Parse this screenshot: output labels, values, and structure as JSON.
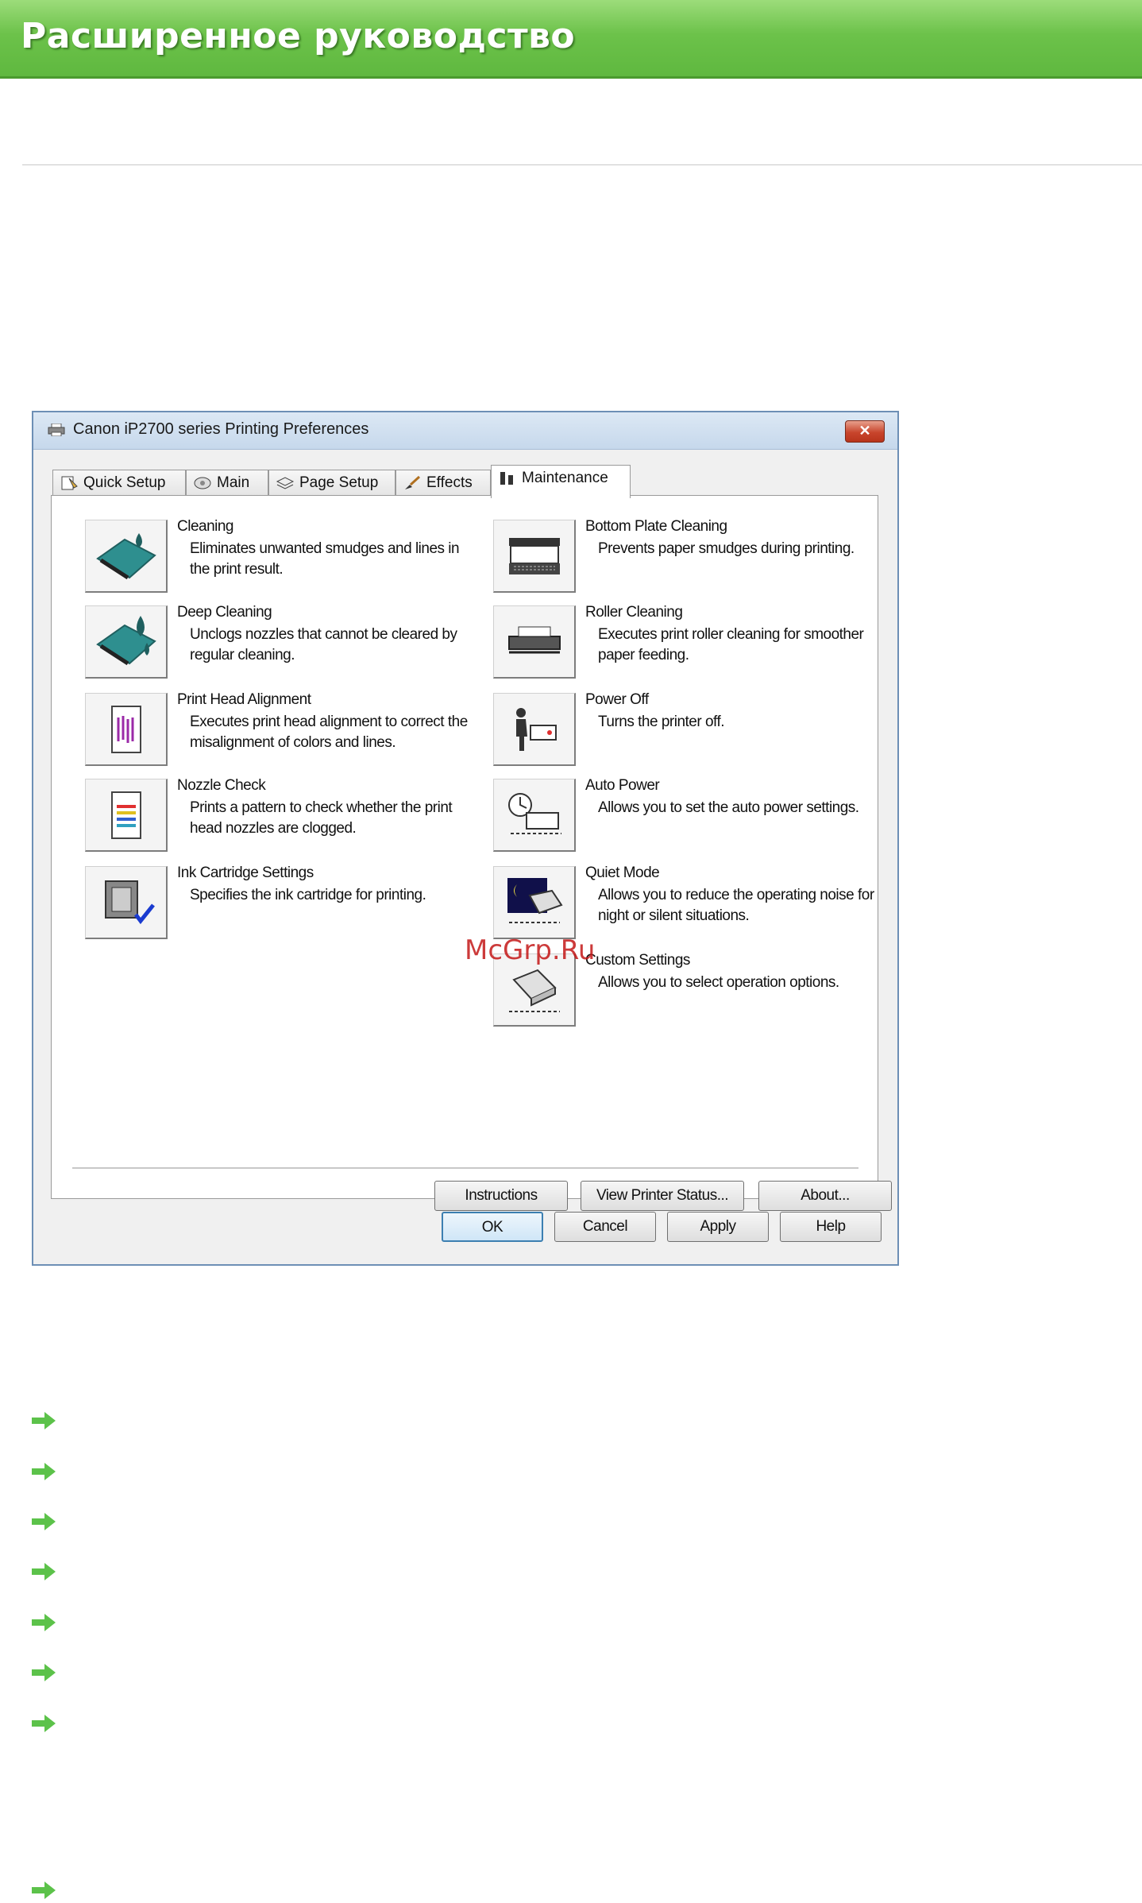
{
  "header": {
    "title": "Расширенное руководство"
  },
  "dialog": {
    "title": "Canon iP2700 series Printing Preferences",
    "close_label": "✕",
    "tabs": [
      {
        "label": "Quick Setup",
        "icon": "quick-setup-icon"
      },
      {
        "label": "Main",
        "icon": "main-icon"
      },
      {
        "label": "Page Setup",
        "icon": "page-setup-icon"
      },
      {
        "label": "Effects",
        "icon": "effects-icon"
      },
      {
        "label": "Maintenance",
        "icon": "maintenance-icon",
        "active": true
      }
    ],
    "left_items": [
      {
        "title": "Cleaning",
        "desc": "Eliminates unwanted smudges and lines in the print result.",
        "icon": "cleaning-icon"
      },
      {
        "title": "Deep Cleaning",
        "desc": "Unclogs nozzles that cannot be cleared by regular cleaning.",
        "icon": "deep-cleaning-icon"
      },
      {
        "title": "Print Head Alignment",
        "desc": "Executes print head alignment to correct the misalignment of colors and lines.",
        "icon": "print-head-alignment-icon"
      },
      {
        "title": "Nozzle Check",
        "desc": "Prints a pattern to check whether the print head nozzles are clogged.",
        "icon": "nozzle-check-icon"
      },
      {
        "title": "Ink Cartridge Settings",
        "desc": "Specifies the ink cartridge for printing.",
        "icon": "ink-cartridge-icon"
      }
    ],
    "right_items": [
      {
        "title": "Bottom Plate Cleaning",
        "desc": "Prevents paper smudges during printing.",
        "icon": "bottom-plate-cleaning-icon"
      },
      {
        "title": "Roller Cleaning",
        "desc": "Executes print roller cleaning for smoother paper feeding.",
        "icon": "roller-cleaning-icon"
      },
      {
        "title": "Power Off",
        "desc": "Turns the printer off.",
        "icon": "power-off-icon"
      },
      {
        "title": "Auto Power",
        "desc": "Allows you to set the auto power settings.",
        "icon": "auto-power-icon"
      },
      {
        "title": "Quiet Mode",
        "desc": "Allows you to reduce the operating noise for night or silent situations.",
        "icon": "quiet-mode-icon"
      },
      {
        "title": "Custom Settings",
        "desc": "Allows you to select operation options.",
        "icon": "custom-settings-icon"
      }
    ],
    "panel_buttons": {
      "instructions": "Instructions",
      "view_status": "View Printer Status...",
      "about": "About..."
    },
    "footer_buttons": {
      "ok": "OK",
      "cancel": "Cancel",
      "apply": "Apply",
      "help": "Help"
    }
  },
  "watermark": "McGrp.Ru",
  "link_arrows_count": 8,
  "colors": {
    "header_green": "#6cc24a",
    "arrow_green": "#5cc24a",
    "dialog_border": "#6d8fb5",
    "close_red": "#c8452c",
    "watermark_red": "#c41818"
  }
}
